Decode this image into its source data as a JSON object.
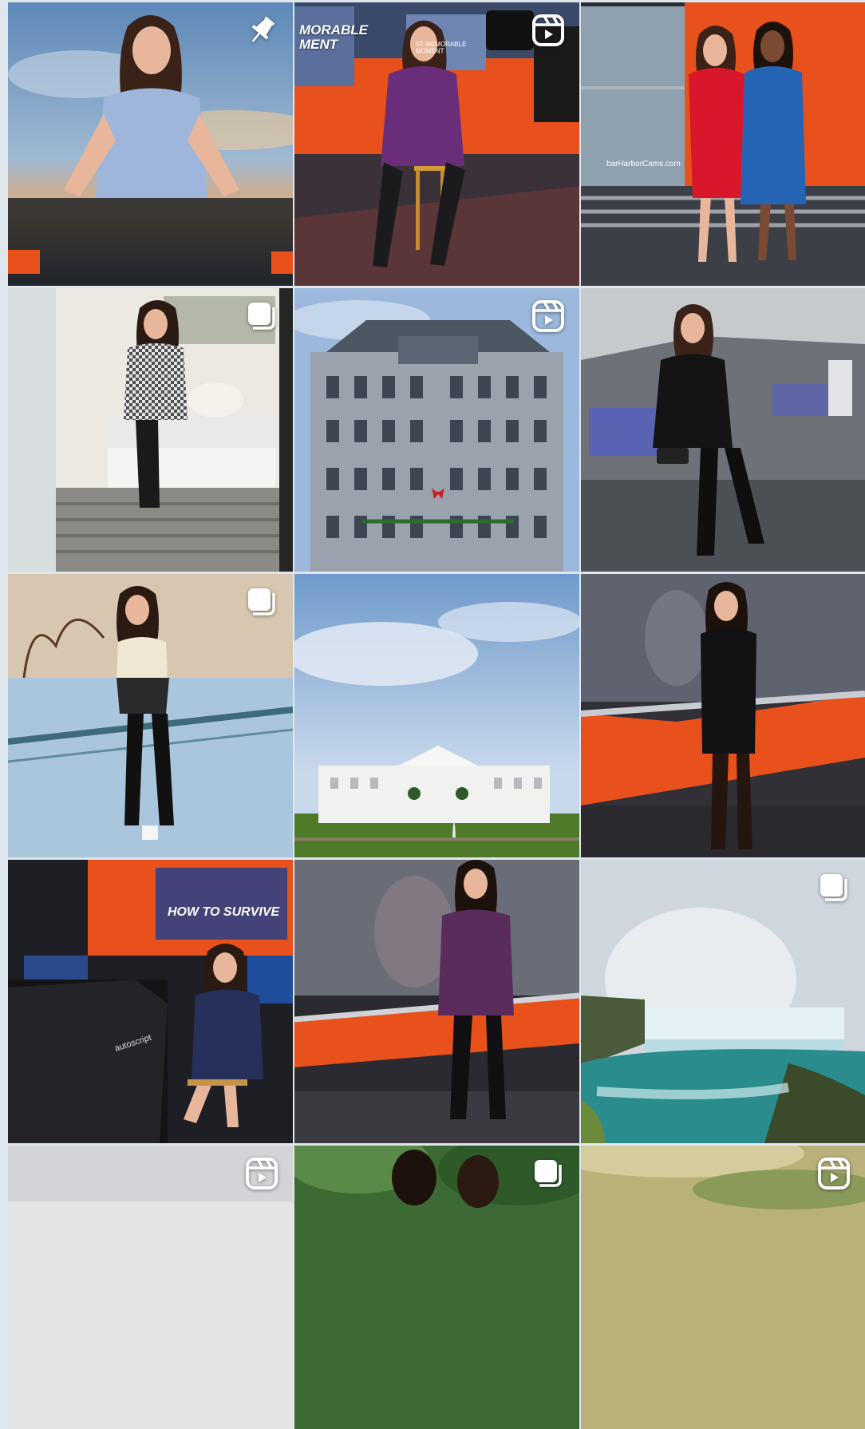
{
  "grid": {
    "tiles": [
      {
        "name": "post-anchor-desk",
        "badge": "pin-icon"
      },
      {
        "name": "post-studio-stool",
        "badge": "reel-icon",
        "screen_text": "MORABLE\nMENT",
        "screen_text_2": "ST MEMORABLE\nMOMENT"
      },
      {
        "name": "post-two-anchors",
        "badge": null,
        "screen_text": "barHarborCams.com"
      },
      {
        "name": "post-hotel-mirror",
        "badge": "carousel-icon"
      },
      {
        "name": "post-eisenhower-building",
        "badge": "reel-icon"
      },
      {
        "name": "post-metro-train",
        "badge": null
      },
      {
        "name": "post-ice-rink",
        "badge": "carousel-icon"
      },
      {
        "name": "post-white-house",
        "badge": null
      },
      {
        "name": "post-black-dress-studio",
        "badge": null
      },
      {
        "name": "post-weather-desk",
        "badge": null,
        "screen_text": "HOW TO SURVIVE",
        "box_text": "autoscript"
      },
      {
        "name": "post-purple-top-studio",
        "badge": null
      },
      {
        "name": "post-niagara-falls",
        "badge": "carousel-icon"
      },
      {
        "name": "post-partial-1",
        "badge": "reel-icon"
      },
      {
        "name": "post-partial-2",
        "badge": "carousel-icon"
      },
      {
        "name": "post-partial-3",
        "badge": "reel-icon"
      }
    ]
  },
  "colors": {
    "studio_orange": "#e8501c",
    "sky_blue": "#8fb2d6",
    "page_bg": "#dfe7ec"
  }
}
